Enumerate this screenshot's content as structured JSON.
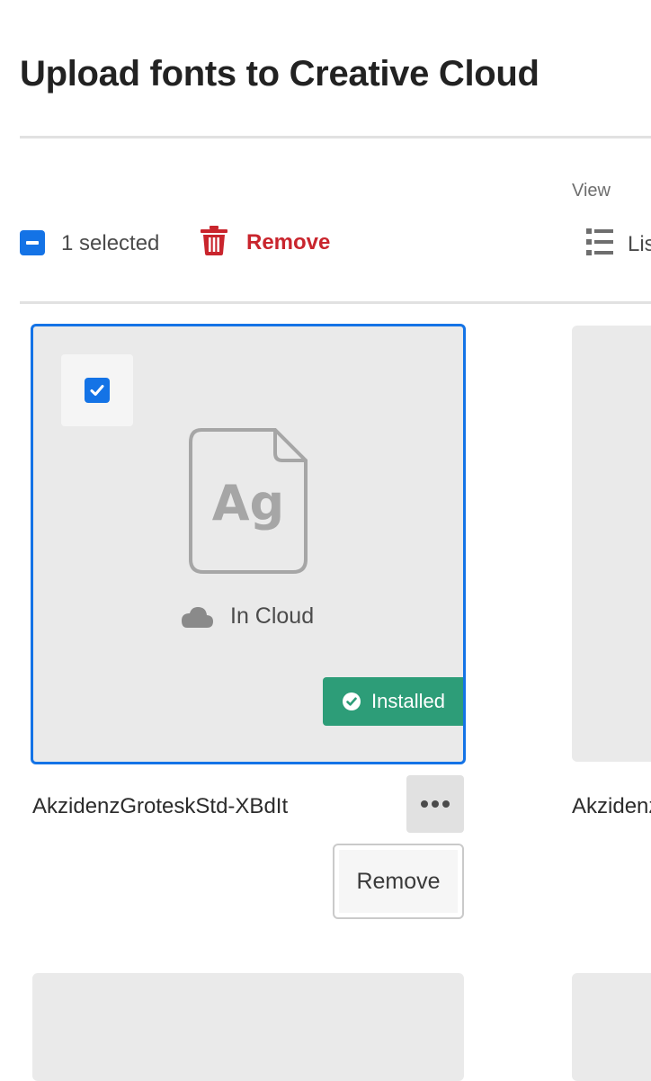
{
  "header": {
    "title": "Upload fonts to Creative Cloud"
  },
  "toolbar": {
    "selected_count": "1 selected",
    "remove_label": "Remove",
    "view_label": "View",
    "view_mode_label": "List",
    "colors": {
      "remove": "#c9252d",
      "accent": "#1473e6"
    }
  },
  "cards": [
    {
      "name": "AkzidenzGroteskStd-XBdIt",
      "selected": true,
      "preview_glyphs": "Ag",
      "cloud_status": "In Cloud",
      "badge": "Installed",
      "badge_color": "#2d9d78",
      "menu": {
        "items": [
          "Remove"
        ]
      }
    },
    {
      "name": "Akzidenz"
    }
  ],
  "icons": {
    "select_all": "checkbox-indeterminate-icon",
    "remove": "trash-icon",
    "view": "list-view-icon",
    "card_check": "checkmark-icon",
    "file": "font-file-icon",
    "cloud": "cloud-icon",
    "installed": "check-circle-icon",
    "more": "more-icon"
  }
}
